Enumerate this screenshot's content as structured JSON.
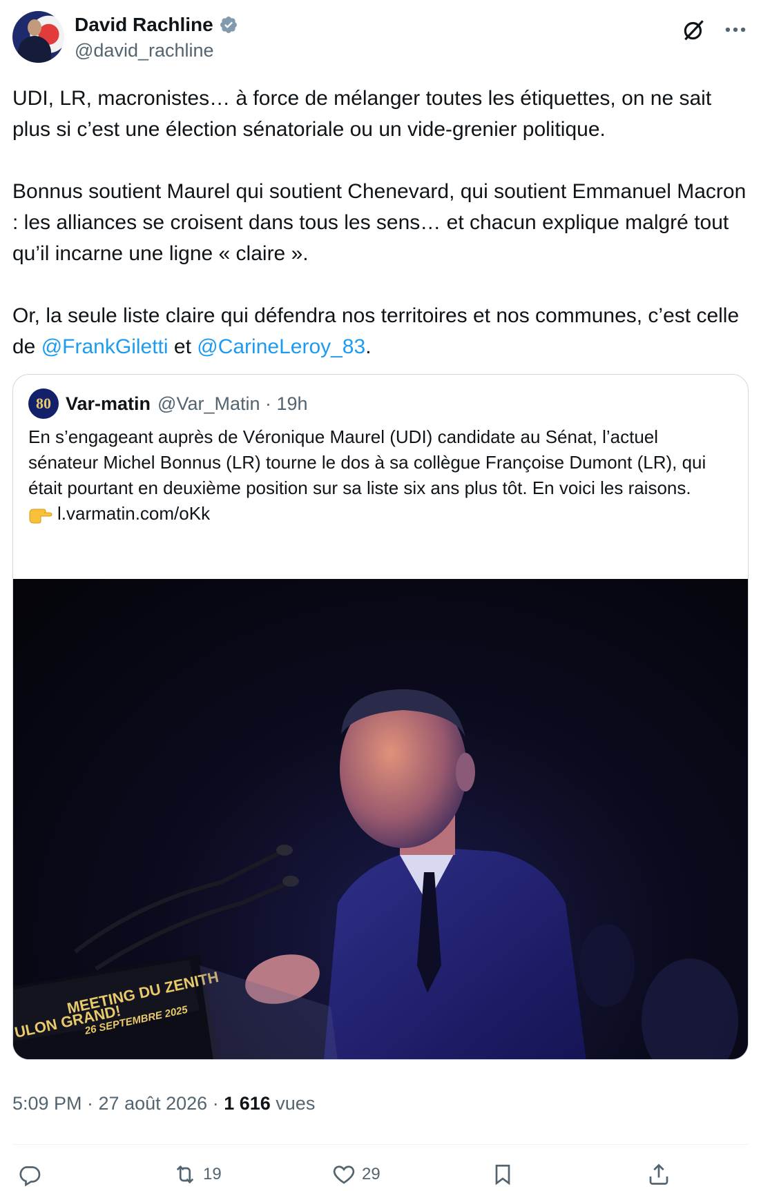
{
  "author": {
    "display_name": "David Rachline",
    "handle": "@david_rachline",
    "verified": true
  },
  "post": {
    "paragraphs": [
      "UDI, LR, macronistes… à force de mélanger toutes les étiquettes, on ne sait plus si c’est une élection sénatoriale ou un vide-grenier politique.",
      "Bonnus soutient Maurel qui soutient Chenevard, qui soutient Emmanuel Macron : les alliances se croisent dans tous les sens… et chacun explique malgré tout qu’il incarne une ligne « claire »."
    ],
    "last_paragraph": {
      "prefix": "Or, la seule liste claire qui défendra nos territoires et nos communes, c’est celle de ",
      "mention1": "@FrankGiletti",
      "middle": " et ",
      "mention2": "@CarineLeroy_83",
      "suffix": "."
    }
  },
  "quoted": {
    "avatar_text": "80",
    "name": "Var-matin",
    "handle_time": "@Var_Matin · 19h",
    "text": "En s’engageant auprès de Véronique Maurel (UDI) candidate au Sénat, l’actuel sénateur Michel Bonnus (LR) tourne le dos à sa collègue Françoise Dumont (LR), qui était pourtant en deuxième position sur sa liste six ans plus tôt. En voici les raisons.",
    "link": "l.varmatin.com/oKk",
    "photo": {
      "sign_line1": "MEETING DU ZENITH",
      "sign_line2": "26 SEPTEMBRE 2025",
      "sign_left": "ULON GRAND!"
    }
  },
  "meta": {
    "time_date": "5:09 PM · 27 août 2026 · ",
    "views_count": "1 616",
    "views_label": " vues"
  },
  "actions": {
    "retweets": "19",
    "likes": "29"
  },
  "colors": {
    "accent": "#1d9bf0",
    "secondary_text": "#536471",
    "border": "#cfd9de"
  }
}
